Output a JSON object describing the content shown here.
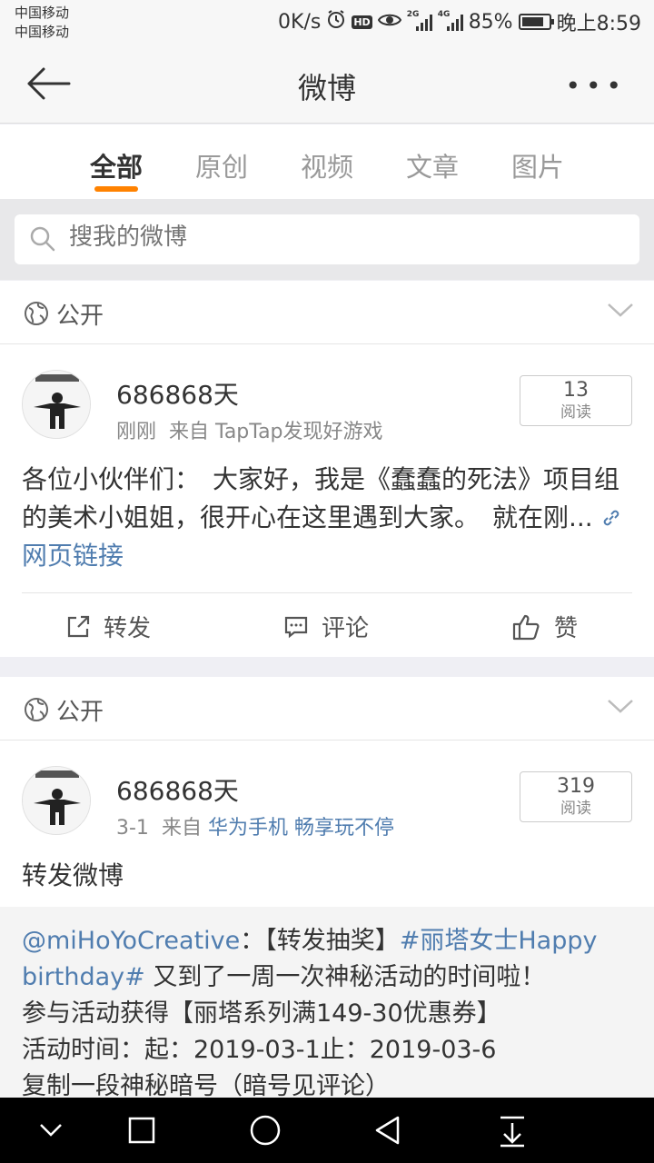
{
  "status": {
    "carrier1": "中国移动",
    "carrier2": "中国移动",
    "speed": "0K/s",
    "hd": "HD",
    "net1": "2G",
    "net2": "4G",
    "battery": "85%",
    "battery_level": 0.85,
    "time": "晚上8:59"
  },
  "nav": {
    "title": "微博",
    "more": "•••"
  },
  "tabs": [
    "全部",
    "原创",
    "视频",
    "文章",
    "图片"
  ],
  "active_tab": "全部",
  "search": {
    "placeholder": "搜我的微博"
  },
  "posts": [
    {
      "visibility": "公开",
      "username": "686868天",
      "time": "刚刚",
      "source_prefix": "来自",
      "source": "TapTap发现好游戏",
      "reads": "13",
      "reads_label": "阅读",
      "text": "各位小伙伴们：　大家好，我是《蠢蠢的死法》项目组的美术小姐姐，很开心在这里遇到大家。　就在刚...",
      "link": "网页链接",
      "actions": {
        "repost": "转发",
        "comment": "评论",
        "like": "赞"
      }
    },
    {
      "visibility": "公开",
      "username": "686868天",
      "time": "3-1",
      "source_prefix": "来自",
      "source": "华为手机 畅享玩不停",
      "reads": "319",
      "reads_label": "阅读",
      "text": "转发微博",
      "retweet": {
        "mention": "@miHoYoCreative",
        "sep": "：【转发抽奖】",
        "topic": "#丽塔女士Happy birthday#",
        "rest": " 又到了一周一次神秘活动的时间啦！",
        "line3": "参与活动获得【丽塔系列满149-30优惠券】",
        "line4": "活动时间：起：2019-03-1止：2019-03-6",
        "line5": "复制一段神秘暗号（暗号见评论）"
      }
    }
  ],
  "colors": {
    "accent": "#ff8200",
    "link": "#507daf"
  }
}
